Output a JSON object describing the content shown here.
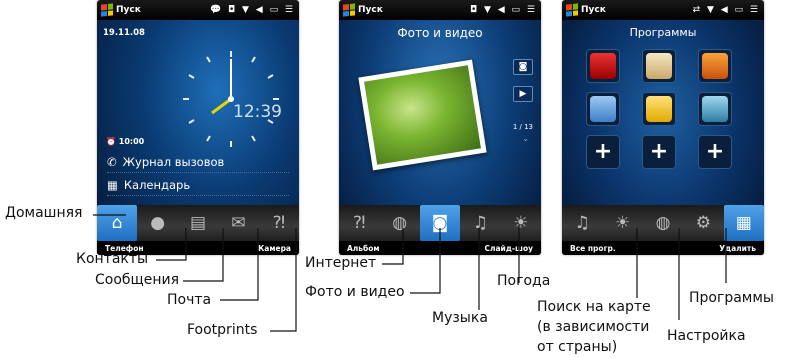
{
  "screen1": {
    "status_title": "Пуск",
    "status_icons": "💬 ◘ ▼ ◀ ▭ ☰",
    "date": "19.11.08",
    "clock_time": "12:39",
    "alarm": "10:00",
    "call_log": "Журнал вызовов",
    "calendar": "Календарь",
    "soft_left": "Телефон",
    "soft_right": "Камера"
  },
  "screen2": {
    "status_title": "Пуск",
    "status_icons": "◘ ▼ ◀ ▭ ☰",
    "title": "Фото и видео",
    "counter": "1 / 13",
    "soft_left": "Альбом",
    "soft_right": "Слайд-шоу"
  },
  "screen3": {
    "status_title": "Пуск",
    "status_icons": "⇄ ▼ ◀ ▭ ☰",
    "title": "Программы",
    "soft_left": "Все прогр.",
    "soft_right": "Удалить"
  },
  "labels": {
    "home": "Домашняя",
    "contacts": "Контакты",
    "messages": "Сообщения",
    "mail": "Почта",
    "footprints": "Footprints",
    "internet": "Интернет",
    "photos": "Фото и видео",
    "music": "Музыка",
    "weather": "Погода",
    "map_line1": "Поиск на карте",
    "map_line2": "(в зависимости",
    "map_line3": "от страны)",
    "settings": "Настройка",
    "programs": "Программы"
  },
  "colors": {
    "accent": "#2f86d8",
    "tab_active": "#1f6fc2"
  }
}
